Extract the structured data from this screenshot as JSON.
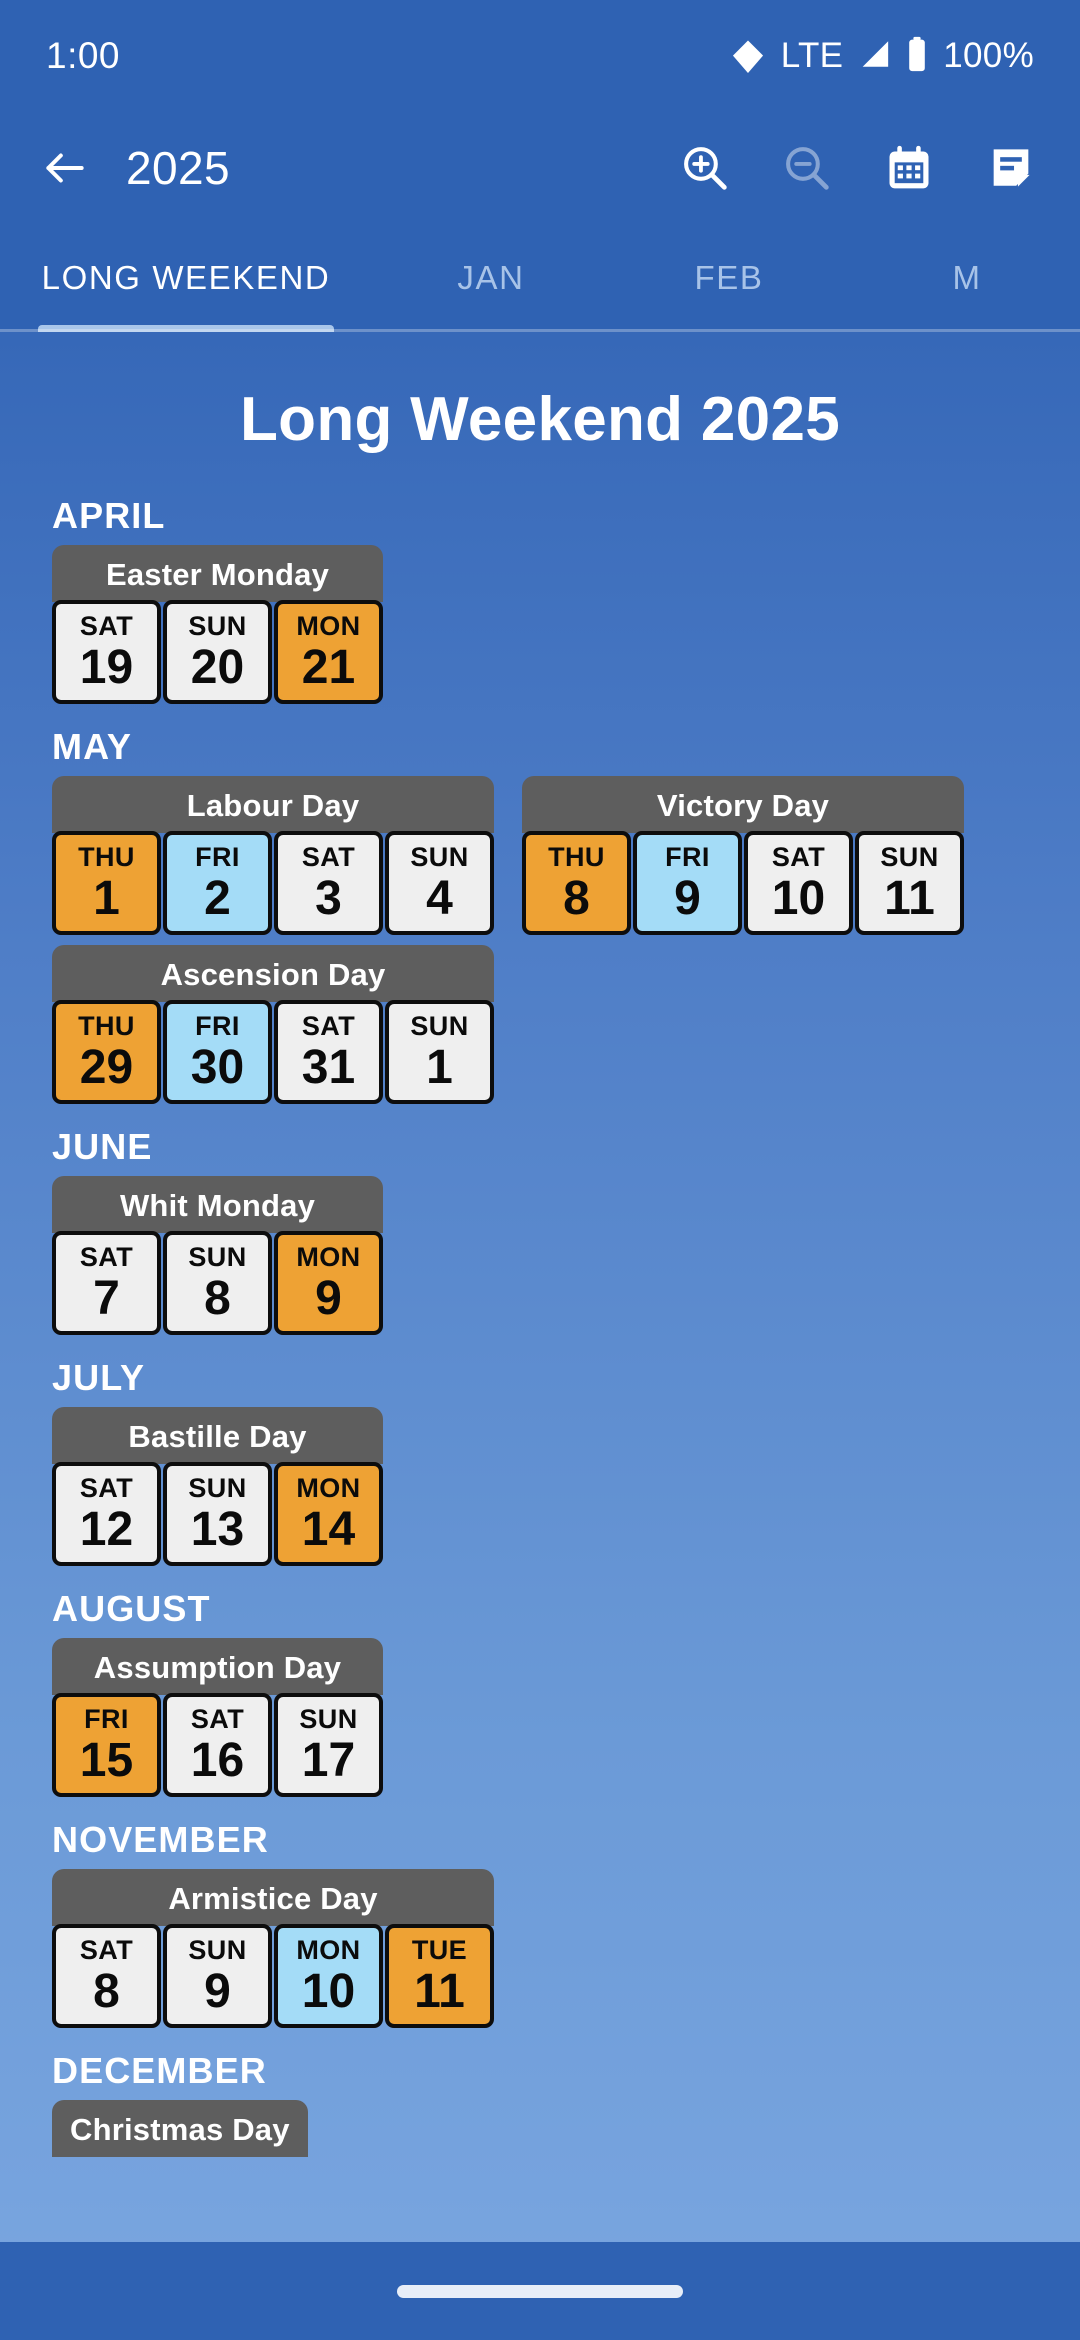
{
  "status_bar": {
    "clock": "1:00",
    "network_label": "LTE",
    "battery_label": "100%",
    "icons": [
      "wifi-icon",
      "signal-icon",
      "battery-icon"
    ]
  },
  "app_bar": {
    "back_icon": "back-arrow-icon",
    "title": "2025",
    "actions": [
      {
        "name": "zoom-in-icon",
        "label": "Zoom in",
        "enabled": true
      },
      {
        "name": "zoom-out-icon",
        "label": "Zoom out",
        "enabled": false
      },
      {
        "name": "calendar-icon",
        "label": "Calendar",
        "enabled": true
      },
      {
        "name": "notes-icon",
        "label": "Notes",
        "enabled": true
      }
    ]
  },
  "tabs": {
    "items": [
      {
        "label": "LONG WEEKEND",
        "active": true
      },
      {
        "label": "JAN",
        "active": false
      },
      {
        "label": "FEB",
        "active": false
      },
      {
        "label": "M",
        "active": false
      }
    ]
  },
  "main": {
    "title": "Long Weekend 2025",
    "months": [
      {
        "label": "APRIL",
        "cards": [
          {
            "name": "Easter Monday",
            "days": [
              {
                "dow": "SAT",
                "num": "19",
                "state": "normal"
              },
              {
                "dow": "SUN",
                "num": "20",
                "state": "normal"
              },
              {
                "dow": "MON",
                "num": "21",
                "state": "holiday"
              }
            ]
          }
        ]
      },
      {
        "label": "MAY",
        "cards": [
          {
            "name": "Labour Day",
            "days": [
              {
                "dow": "THU",
                "num": "1",
                "state": "holiday"
              },
              {
                "dow": "FRI",
                "num": "2",
                "state": "bridge"
              },
              {
                "dow": "SAT",
                "num": "3",
                "state": "normal"
              },
              {
                "dow": "SUN",
                "num": "4",
                "state": "normal"
              }
            ]
          },
          {
            "name": "Victory Day",
            "days": [
              {
                "dow": "THU",
                "num": "8",
                "state": "holiday"
              },
              {
                "dow": "FRI",
                "num": "9",
                "state": "bridge"
              },
              {
                "dow": "SAT",
                "num": "10",
                "state": "normal"
              },
              {
                "dow": "SUN",
                "num": "11",
                "state": "normal"
              }
            ]
          },
          {
            "name": "Ascension Day",
            "days": [
              {
                "dow": "THU",
                "num": "29",
                "state": "holiday"
              },
              {
                "dow": "FRI",
                "num": "30",
                "state": "bridge"
              },
              {
                "dow": "SAT",
                "num": "31",
                "state": "normal"
              },
              {
                "dow": "SUN",
                "num": "1",
                "state": "normal"
              }
            ]
          }
        ]
      },
      {
        "label": "JUNE",
        "cards": [
          {
            "name": "Whit Monday",
            "days": [
              {
                "dow": "SAT",
                "num": "7",
                "state": "normal"
              },
              {
                "dow": "SUN",
                "num": "8",
                "state": "normal"
              },
              {
                "dow": "MON",
                "num": "9",
                "state": "holiday"
              }
            ]
          }
        ]
      },
      {
        "label": "JULY",
        "cards": [
          {
            "name": "Bastille Day",
            "days": [
              {
                "dow": "SAT",
                "num": "12",
                "state": "normal"
              },
              {
                "dow": "SUN",
                "num": "13",
                "state": "normal"
              },
              {
                "dow": "MON",
                "num": "14",
                "state": "holiday"
              }
            ]
          }
        ]
      },
      {
        "label": "AUGUST",
        "cards": [
          {
            "name": "Assumption Day",
            "days": [
              {
                "dow": "FRI",
                "num": "15",
                "state": "holiday"
              },
              {
                "dow": "SAT",
                "num": "16",
                "state": "normal"
              },
              {
                "dow": "SUN",
                "num": "17",
                "state": "normal"
              }
            ]
          }
        ]
      },
      {
        "label": "NOVEMBER",
        "cards": [
          {
            "name": "Armistice Day",
            "days": [
              {
                "dow": "SAT",
                "num": "8",
                "state": "normal"
              },
              {
                "dow": "SUN",
                "num": "9",
                "state": "normal"
              },
              {
                "dow": "MON",
                "num": "10",
                "state": "bridge"
              },
              {
                "dow": "TUE",
                "num": "11",
                "state": "holiday"
              }
            ]
          }
        ]
      },
      {
        "label": "DECEMBER",
        "cards": [
          {
            "name": "Christmas Day",
            "days": []
          }
        ]
      }
    ]
  },
  "nav_bar": {
    "home_pill": "home-indicator"
  },
  "colors": {
    "brand_blue": "#2f62b3",
    "holiday_orange": "#eea234",
    "bridge_blue": "#a4dcf7",
    "day_neutral": "#efefef",
    "card_header_gray": "#5e5e5e"
  }
}
